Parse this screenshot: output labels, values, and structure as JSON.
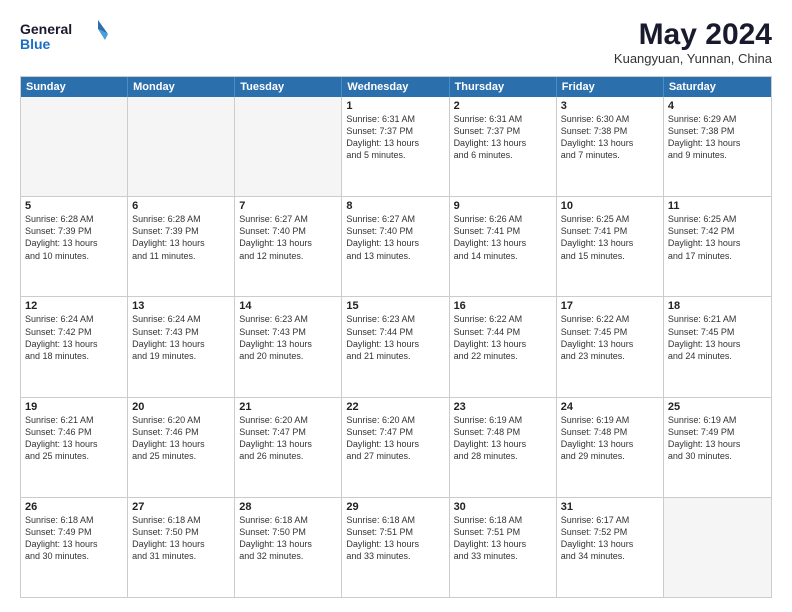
{
  "logo": {
    "line1": "General",
    "line2": "Blue"
  },
  "title": "May 2024",
  "subtitle": "Kuangyuan, Yunnan, China",
  "days_of_week": [
    "Sunday",
    "Monday",
    "Tuesday",
    "Wednesday",
    "Thursday",
    "Friday",
    "Saturday"
  ],
  "weeks": [
    [
      {
        "day": "",
        "lines": [],
        "empty": true
      },
      {
        "day": "",
        "lines": [],
        "empty": true
      },
      {
        "day": "",
        "lines": [],
        "empty": true
      },
      {
        "day": "1",
        "lines": [
          "Sunrise: 6:31 AM",
          "Sunset: 7:37 PM",
          "Daylight: 13 hours",
          "and 5 minutes."
        ]
      },
      {
        "day": "2",
        "lines": [
          "Sunrise: 6:31 AM",
          "Sunset: 7:37 PM",
          "Daylight: 13 hours",
          "and 6 minutes."
        ]
      },
      {
        "day": "3",
        "lines": [
          "Sunrise: 6:30 AM",
          "Sunset: 7:38 PM",
          "Daylight: 13 hours",
          "and 7 minutes."
        ]
      },
      {
        "day": "4",
        "lines": [
          "Sunrise: 6:29 AM",
          "Sunset: 7:38 PM",
          "Daylight: 13 hours",
          "and 9 minutes."
        ]
      }
    ],
    [
      {
        "day": "5",
        "lines": [
          "Sunrise: 6:28 AM",
          "Sunset: 7:39 PM",
          "Daylight: 13 hours",
          "and 10 minutes."
        ]
      },
      {
        "day": "6",
        "lines": [
          "Sunrise: 6:28 AM",
          "Sunset: 7:39 PM",
          "Daylight: 13 hours",
          "and 11 minutes."
        ]
      },
      {
        "day": "7",
        "lines": [
          "Sunrise: 6:27 AM",
          "Sunset: 7:40 PM",
          "Daylight: 13 hours",
          "and 12 minutes."
        ]
      },
      {
        "day": "8",
        "lines": [
          "Sunrise: 6:27 AM",
          "Sunset: 7:40 PM",
          "Daylight: 13 hours",
          "and 13 minutes."
        ]
      },
      {
        "day": "9",
        "lines": [
          "Sunrise: 6:26 AM",
          "Sunset: 7:41 PM",
          "Daylight: 13 hours",
          "and 14 minutes."
        ]
      },
      {
        "day": "10",
        "lines": [
          "Sunrise: 6:25 AM",
          "Sunset: 7:41 PM",
          "Daylight: 13 hours",
          "and 15 minutes."
        ]
      },
      {
        "day": "11",
        "lines": [
          "Sunrise: 6:25 AM",
          "Sunset: 7:42 PM",
          "Daylight: 13 hours",
          "and 17 minutes."
        ]
      }
    ],
    [
      {
        "day": "12",
        "lines": [
          "Sunrise: 6:24 AM",
          "Sunset: 7:42 PM",
          "Daylight: 13 hours",
          "and 18 minutes."
        ]
      },
      {
        "day": "13",
        "lines": [
          "Sunrise: 6:24 AM",
          "Sunset: 7:43 PM",
          "Daylight: 13 hours",
          "and 19 minutes."
        ]
      },
      {
        "day": "14",
        "lines": [
          "Sunrise: 6:23 AM",
          "Sunset: 7:43 PM",
          "Daylight: 13 hours",
          "and 20 minutes."
        ]
      },
      {
        "day": "15",
        "lines": [
          "Sunrise: 6:23 AM",
          "Sunset: 7:44 PM",
          "Daylight: 13 hours",
          "and 21 minutes."
        ]
      },
      {
        "day": "16",
        "lines": [
          "Sunrise: 6:22 AM",
          "Sunset: 7:44 PM",
          "Daylight: 13 hours",
          "and 22 minutes."
        ]
      },
      {
        "day": "17",
        "lines": [
          "Sunrise: 6:22 AM",
          "Sunset: 7:45 PM",
          "Daylight: 13 hours",
          "and 23 minutes."
        ]
      },
      {
        "day": "18",
        "lines": [
          "Sunrise: 6:21 AM",
          "Sunset: 7:45 PM",
          "Daylight: 13 hours",
          "and 24 minutes."
        ]
      }
    ],
    [
      {
        "day": "19",
        "lines": [
          "Sunrise: 6:21 AM",
          "Sunset: 7:46 PM",
          "Daylight: 13 hours",
          "and 25 minutes."
        ]
      },
      {
        "day": "20",
        "lines": [
          "Sunrise: 6:20 AM",
          "Sunset: 7:46 PM",
          "Daylight: 13 hours",
          "and 25 minutes."
        ]
      },
      {
        "day": "21",
        "lines": [
          "Sunrise: 6:20 AM",
          "Sunset: 7:47 PM",
          "Daylight: 13 hours",
          "and 26 minutes."
        ]
      },
      {
        "day": "22",
        "lines": [
          "Sunrise: 6:20 AM",
          "Sunset: 7:47 PM",
          "Daylight: 13 hours",
          "and 27 minutes."
        ]
      },
      {
        "day": "23",
        "lines": [
          "Sunrise: 6:19 AM",
          "Sunset: 7:48 PM",
          "Daylight: 13 hours",
          "and 28 minutes."
        ]
      },
      {
        "day": "24",
        "lines": [
          "Sunrise: 6:19 AM",
          "Sunset: 7:48 PM",
          "Daylight: 13 hours",
          "and 29 minutes."
        ]
      },
      {
        "day": "25",
        "lines": [
          "Sunrise: 6:19 AM",
          "Sunset: 7:49 PM",
          "Daylight: 13 hours",
          "and 30 minutes."
        ]
      }
    ],
    [
      {
        "day": "26",
        "lines": [
          "Sunrise: 6:18 AM",
          "Sunset: 7:49 PM",
          "Daylight: 13 hours",
          "and 30 minutes."
        ]
      },
      {
        "day": "27",
        "lines": [
          "Sunrise: 6:18 AM",
          "Sunset: 7:50 PM",
          "Daylight: 13 hours",
          "and 31 minutes."
        ]
      },
      {
        "day": "28",
        "lines": [
          "Sunrise: 6:18 AM",
          "Sunset: 7:50 PM",
          "Daylight: 13 hours",
          "and 32 minutes."
        ]
      },
      {
        "day": "29",
        "lines": [
          "Sunrise: 6:18 AM",
          "Sunset: 7:51 PM",
          "Daylight: 13 hours",
          "and 33 minutes."
        ]
      },
      {
        "day": "30",
        "lines": [
          "Sunrise: 6:18 AM",
          "Sunset: 7:51 PM",
          "Daylight: 13 hours",
          "and 33 minutes."
        ]
      },
      {
        "day": "31",
        "lines": [
          "Sunrise: 6:17 AM",
          "Sunset: 7:52 PM",
          "Daylight: 13 hours",
          "and 34 minutes."
        ]
      },
      {
        "day": "",
        "lines": [],
        "empty": true
      }
    ]
  ]
}
